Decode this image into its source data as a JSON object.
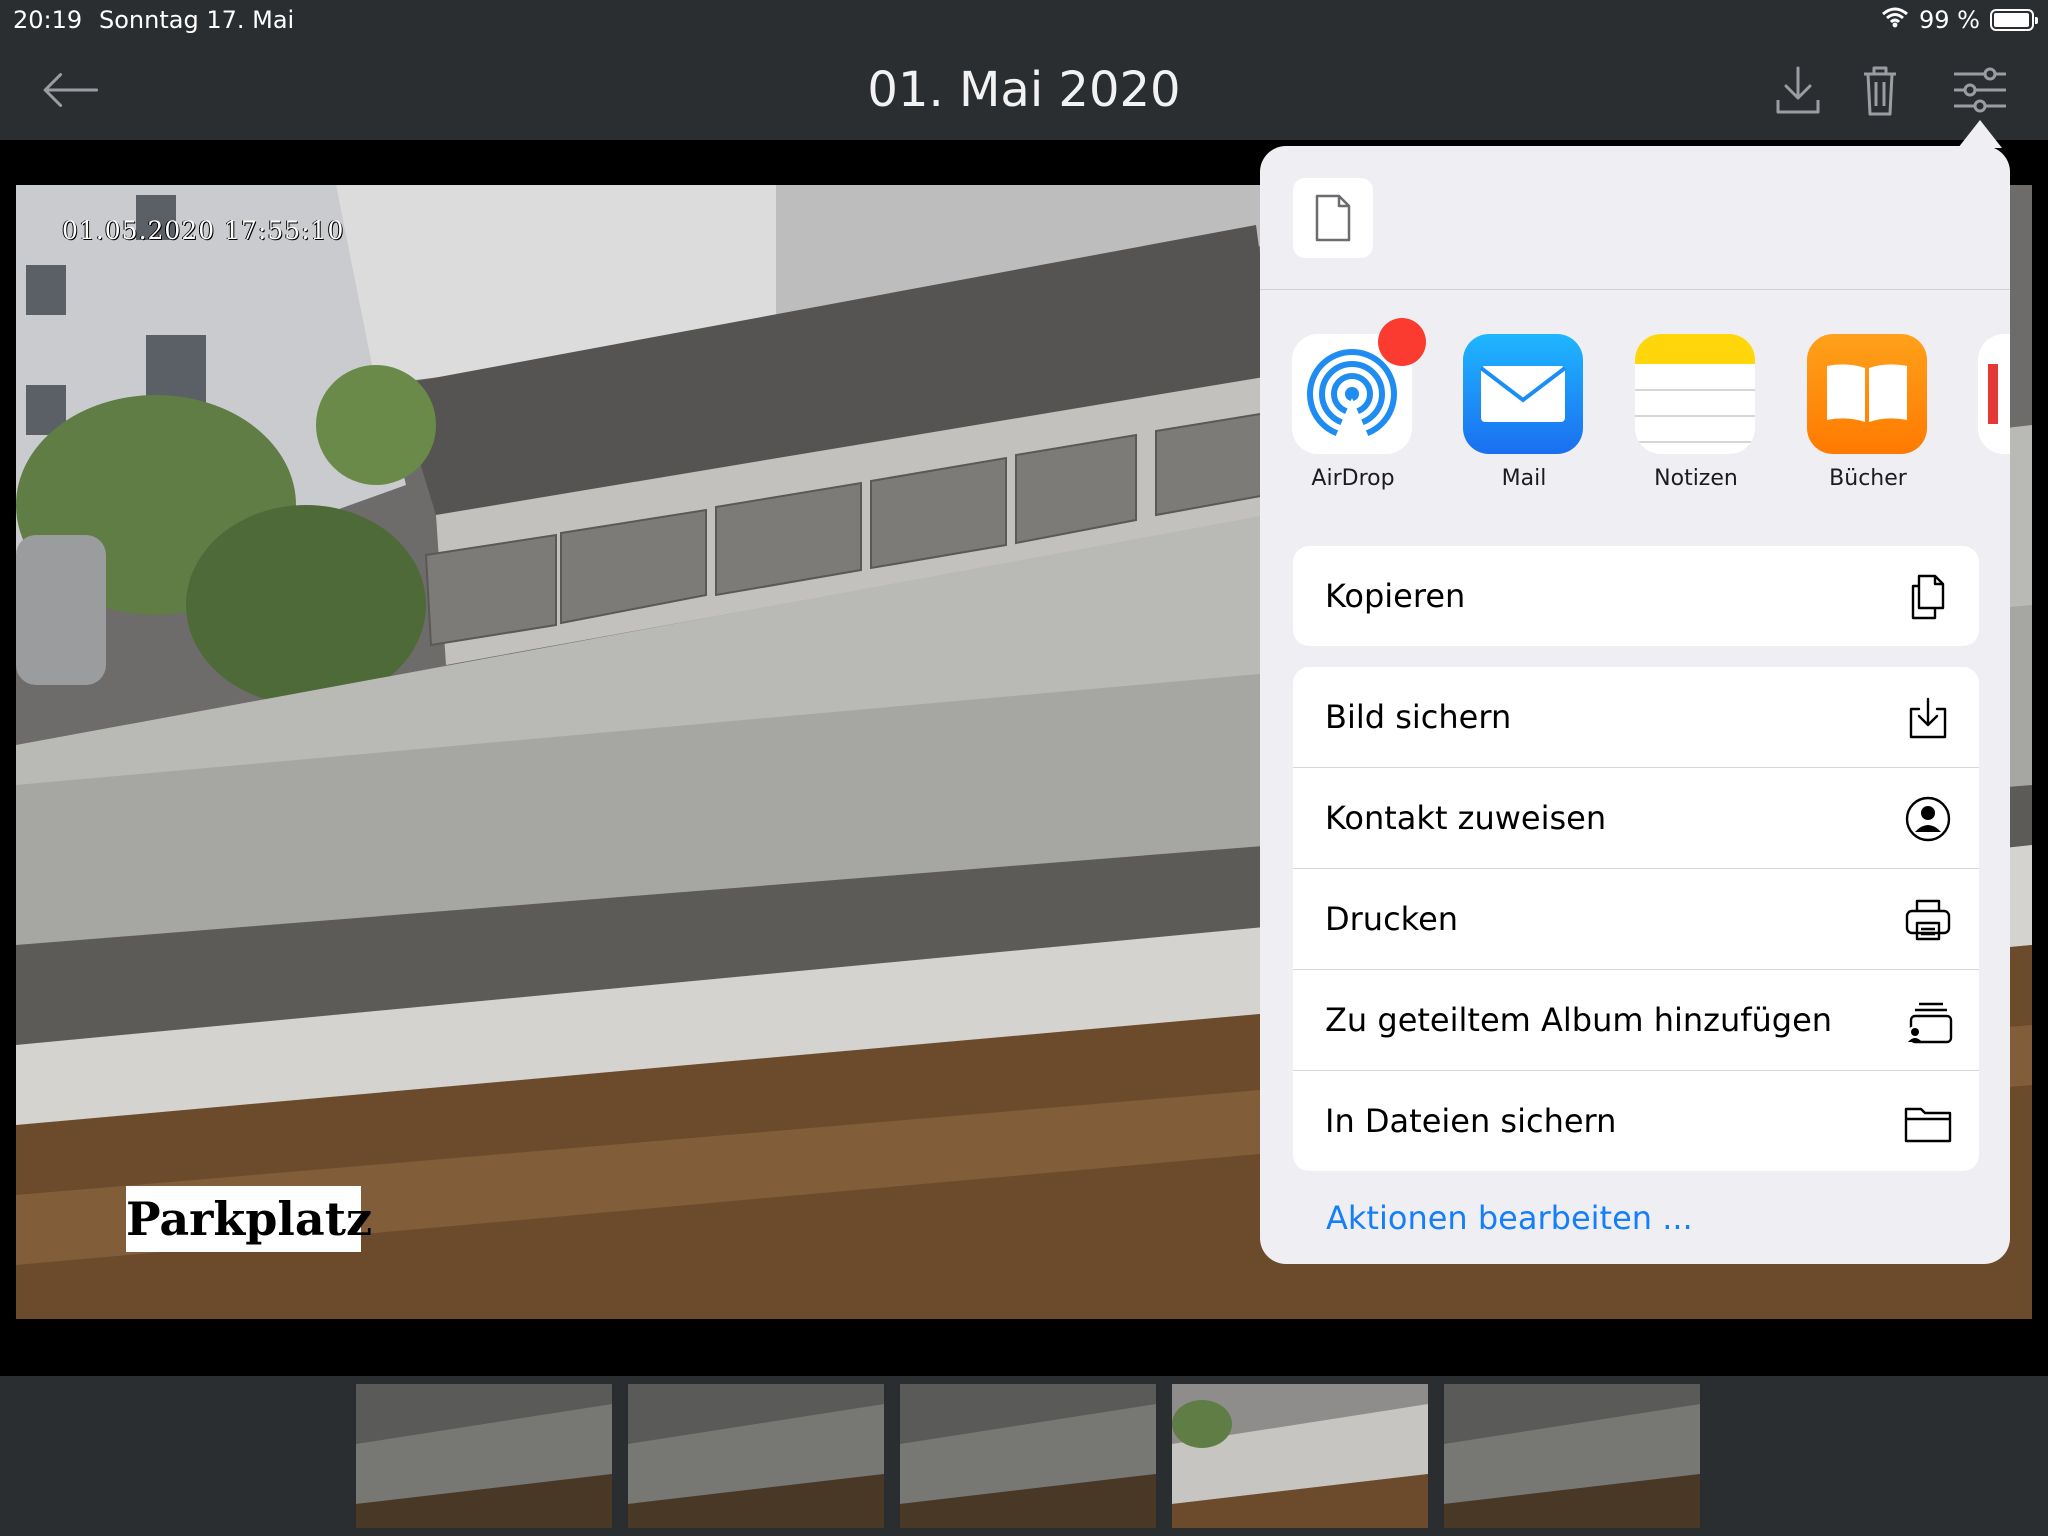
{
  "status_bar": {
    "time": "20:19",
    "date": "Sonntag 17. Mai",
    "battery": "99 %",
    "icons": [
      "wifi-icon",
      "battery-icon"
    ]
  },
  "nav": {
    "title": "01. Mai 2020",
    "icons": [
      "back-arrow-icon",
      "download-icon",
      "trash-icon",
      "filter-sliders-icon"
    ]
  },
  "photo": {
    "overlay_timestamp": "01.05.2020 17:55:10",
    "overlay_label": "Parkplatz"
  },
  "thumbnails": {
    "count": 5,
    "selected_index": 3
  },
  "share_sheet": {
    "document_icon": "document-icon",
    "apps": [
      {
        "label": "AirDrop",
        "icon": "airdrop-icon",
        "color": "#1e8cf0",
        "badge": true
      },
      {
        "label": "Mail",
        "icon": "mail-icon",
        "color": "#1a8ef5"
      },
      {
        "label": "Notizen",
        "icon": "notes-icon",
        "color": "#ffd60a"
      },
      {
        "label": "Bücher",
        "icon": "books-icon",
        "color": "#ff8a00"
      }
    ],
    "actions_group1": [
      {
        "label": "Kopieren",
        "icon": "copy-icon"
      }
    ],
    "actions_group2": [
      {
        "label": "Bild sichern",
        "icon": "save-image-icon"
      },
      {
        "label": "Kontakt zuweisen",
        "icon": "contact-icon"
      },
      {
        "label": "Drucken",
        "icon": "printer-icon"
      },
      {
        "label": "Zu geteiltem Album hinzufügen",
        "icon": "shared-album-icon"
      },
      {
        "label": "In Dateien sichern",
        "icon": "folder-icon"
      }
    ],
    "edit_actions": "Aktionen bearbeiten ...",
    "accent_color": "#147efb"
  }
}
